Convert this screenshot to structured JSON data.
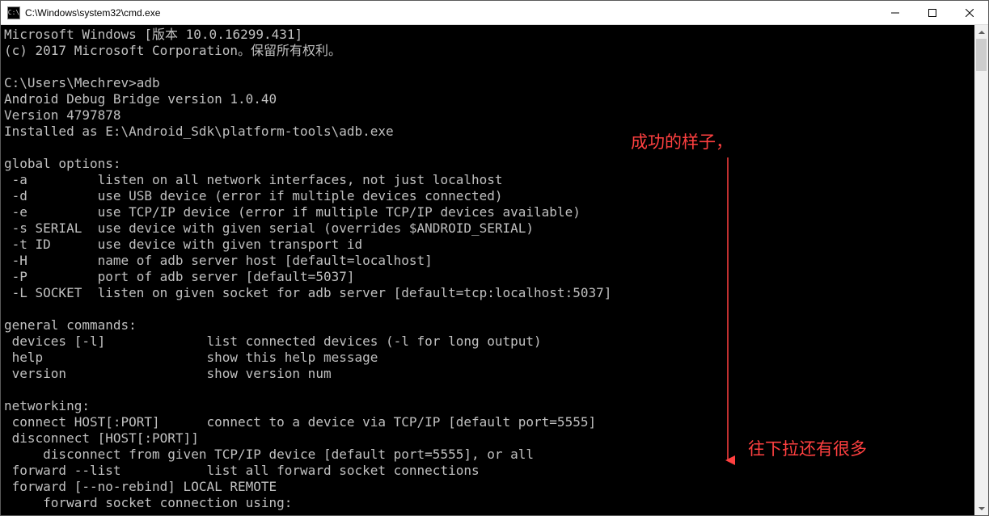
{
  "window": {
    "title": "C:\\Windows\\system32\\cmd.exe",
    "icon_text": "C:\\"
  },
  "console_lines": [
    "Microsoft Windows [版本 10.0.16299.431]",
    "(c) 2017 Microsoft Corporation。保留所有权利。",
    "",
    "C:\\Users\\Mechrev>adb",
    "Android Debug Bridge version 1.0.40",
    "Version 4797878",
    "Installed as E:\\Android_Sdk\\platform-tools\\adb.exe",
    "",
    "global options:",
    " -a         listen on all network interfaces, not just localhost",
    " -d         use USB device (error if multiple devices connected)",
    " -e         use TCP/IP device (error if multiple TCP/IP devices available)",
    " -s SERIAL  use device with given serial (overrides $ANDROID_SERIAL)",
    " -t ID      use device with given transport id",
    " -H         name of adb server host [default=localhost]",
    " -P         port of adb server [default=5037]",
    " -L SOCKET  listen on given socket for adb server [default=tcp:localhost:5037]",
    "",
    "general commands:",
    " devices [-l]             list connected devices (-l for long output)",
    " help                     show this help message",
    " version                  show version num",
    "",
    "networking:",
    " connect HOST[:PORT]      connect to a device via TCP/IP [default port=5555]",
    " disconnect [HOST[:PORT]]",
    "     disconnect from given TCP/IP device [default port=5555], or all",
    " forward --list           list all forward socket connections",
    " forward [--no-rebind] LOCAL REMOTE",
    "     forward socket connection using:"
  ],
  "annotations": {
    "top": "成功的样子，",
    "bottom": "往下拉还有很多"
  }
}
